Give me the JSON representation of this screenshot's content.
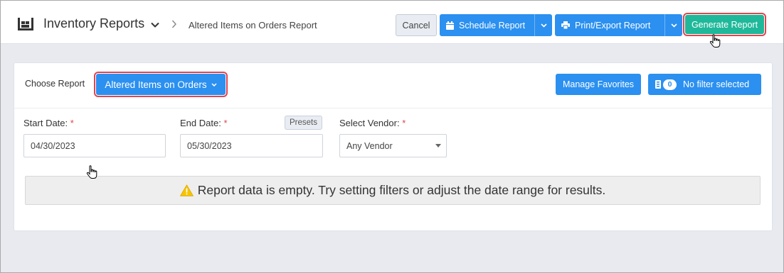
{
  "header": {
    "title": "Inventory Reports",
    "breadcrumb": "Altered Items on Orders Report",
    "icons": {
      "module": "warehouse-icon",
      "title_menu": "chevron-down-icon",
      "separator": "chevron-right-icon"
    }
  },
  "toolbar": {
    "cancel_label": "Cancel",
    "schedule_label": "Schedule Report",
    "print_label": "Print/Export Report",
    "generate_label": "Generate Report"
  },
  "report_bar": {
    "choose_label": "Choose Report",
    "selected_report": "Altered Items on Orders",
    "manage_favorites_label": "Manage Favorites",
    "filter_count": "0",
    "filter_label": "No filter selected"
  },
  "filters": {
    "start_date": {
      "label": "Start Date:",
      "required_mark": "*",
      "value": "04/30/2023"
    },
    "end_date": {
      "label": "End Date:",
      "required_mark": "*",
      "value": "05/30/2023"
    },
    "presets_label": "Presets",
    "vendor": {
      "label": "Select Vendor:",
      "required_mark": "*",
      "value": "Any Vendor"
    }
  },
  "message": {
    "icon": "warning-icon",
    "text": "Report data is empty. Try setting filters or adjust the date range for results."
  },
  "colors": {
    "primary": "#2b90f0",
    "success": "#1fb89a",
    "highlight": "#e0454f",
    "warning": "#f5c400",
    "required": "#e0454f"
  }
}
